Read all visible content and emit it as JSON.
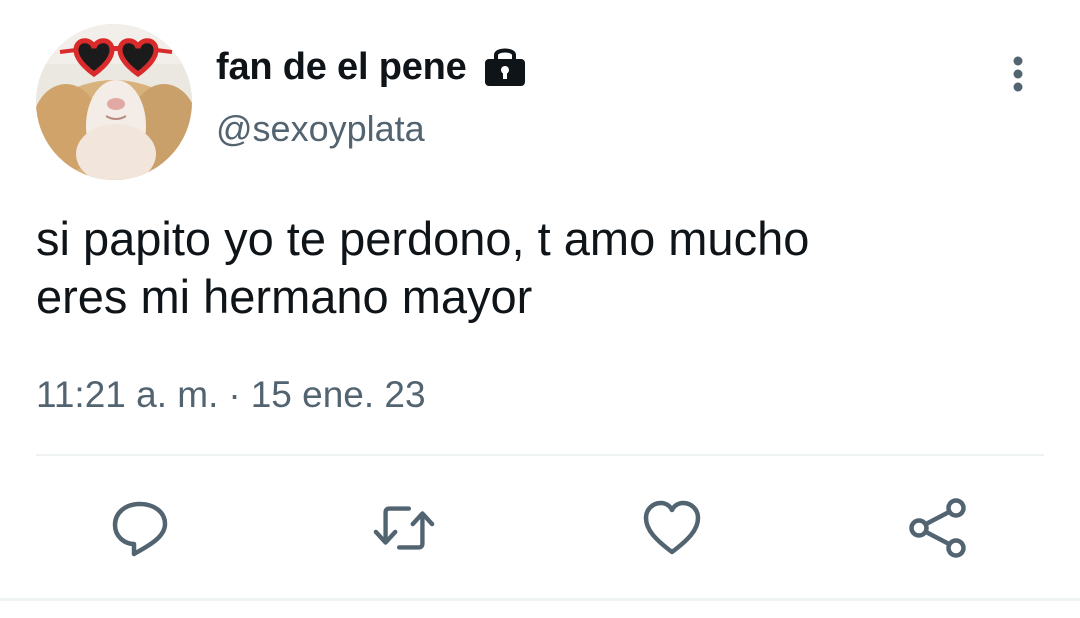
{
  "tweet": {
    "author": {
      "display_name": "fan de el pene",
      "handle": "@sexoyplata",
      "avatar_icon": "guinea-pig-heart-sunglasses-avatar",
      "protected_icon": "lock-icon"
    },
    "menu_icon": "more-vertical-icon",
    "text": "si papito yo te perdono, t amo mucho\neres mi hermano mayor",
    "time": "11:21 a. m.",
    "separator": "·",
    "date": "15 ene. 23",
    "actions": [
      {
        "name": "reply",
        "icon": "reply-icon"
      },
      {
        "name": "retweet",
        "icon": "retweet-icon"
      },
      {
        "name": "like",
        "icon": "heart-icon"
      },
      {
        "name": "share",
        "icon": "share-icon"
      }
    ]
  },
  "colors": {
    "text_primary": "#0f1419",
    "text_secondary": "#536471",
    "icon": "#536471",
    "divider": "#eff3f4",
    "background": "#ffffff"
  }
}
